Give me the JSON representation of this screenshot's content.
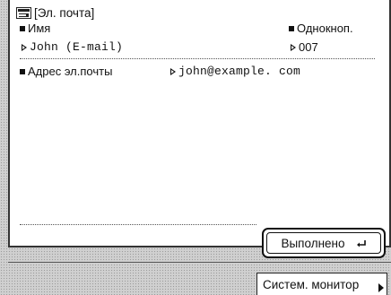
{
  "header": {
    "title": "[Эл. почта]",
    "icon": "email-address-book-icon"
  },
  "fields": {
    "name_label": "Имя",
    "name_value": "John (E-mail)",
    "onetouch_label": "Однокноп.",
    "onetouch_value": "007",
    "email_label": "Адрес эл.почты",
    "email_value": "john@example. com"
  },
  "buttons": {
    "done_label": "Выполнено",
    "done_icon": "enter-return-icon",
    "system_monitor_label": "Систем. монитор"
  }
}
